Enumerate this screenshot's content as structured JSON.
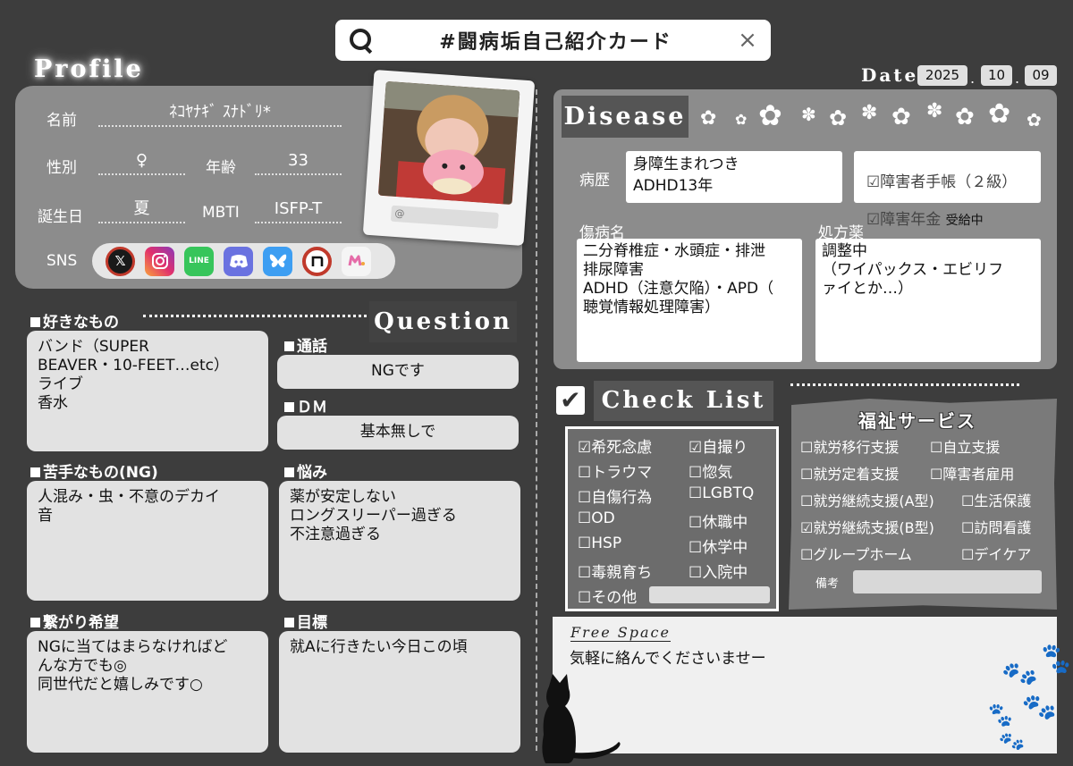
{
  "search": {
    "text": "#闘病垢自己紹介カード",
    "close": "×"
  },
  "profile": {
    "title": "Profile",
    "name_label": "名前",
    "name": "ﾈｺﾔﾅｷﾞ ｽﾅﾄﾞﾘ*",
    "gender_label": "性別",
    "gender": "♀",
    "age_label": "年齢",
    "age": "33",
    "birthday_label": "誕生日",
    "birthday": "夏",
    "mbti_label": "MBTI",
    "mbti": "ISFP-T",
    "sns_label": "SNS",
    "sns_icons": [
      "x-icon",
      "instagram-icon",
      "line-icon",
      "discord-icon",
      "bluesky-icon",
      "note-icon",
      "misskey-icon"
    ],
    "sns_icon_text": {
      "x": "𝕏",
      "line": "LINE"
    },
    "photo_caption": "@"
  },
  "date": {
    "label": "Date",
    "year": "2025",
    "month": "10",
    "day": "09",
    "sep": "."
  },
  "likes": {
    "header": "好きなもの",
    "text": "バンド（SUPER\nBEAVER・10-FEET…etc）\nライブ\n香水"
  },
  "dislikes": {
    "header": "苦手なもの(NG)",
    "text": "人混み・虫・不意のデカイ\n音"
  },
  "connect": {
    "header": "繋がり希望",
    "text": "NGに当てはまらなければど\nんな方でも◎\n同世代だと嬉しみです○"
  },
  "question": {
    "tag": "Question",
    "call_header": "通話",
    "call": "NGです",
    "dm_header": "ＤＭ",
    "dm": "基本無しで",
    "worry_header": "悩み",
    "worry": "薬が安定しない\nロングスリーパー過ぎる\n不注意過ぎる",
    "goal_header": "目標",
    "goal": "就Aに行きたい今日この頃"
  },
  "disease": {
    "tag": "Disease",
    "history_label": "病歴",
    "history": "身障生まれつき\nADHD13年",
    "cert1": "☑障害者手帳（２級）",
    "cert2": "☑障害年金",
    "cert2_note": "受給中",
    "diagnosis_label": "傷病名",
    "diagnosis": "二分脊椎症・水頭症・排泄\n排尿障害\nADHD（注意欠陥）・APD（\n聴覚情報処理障害）",
    "meds_label": "処方薬",
    "meds": "調整中\n（ワイパックス・エビリフ\nァイとか…）"
  },
  "checklist": {
    "tag": "Check List",
    "check_glyph": "✔",
    "left": [
      "☑希死念慮",
      "☐トラウマ",
      "☐自傷行為",
      "☐OD",
      "☐HSP",
      "☐毒親育ち",
      "☐その他"
    ],
    "right": [
      "☑自撮り",
      "☐惚気",
      "☐LGBTQ",
      "☐休職中",
      "☐休学中",
      "☐入院中"
    ]
  },
  "welfare": {
    "title": "福祉サービス",
    "items_left": [
      "☐就労移行支援",
      "☐就労定着支援",
      "☐就労継続支援(A型)",
      "☑就労継続支援(B型)",
      "☐グループホーム"
    ],
    "items_right": [
      "☐自立支援",
      "☐障害者雇用",
      "☐生活保護",
      "☐訪問看護",
      "☐デイケア"
    ],
    "note_label": "備考"
  },
  "freespace": {
    "label": "Free Space",
    "text": "気軽に絡んでくださいませー"
  }
}
